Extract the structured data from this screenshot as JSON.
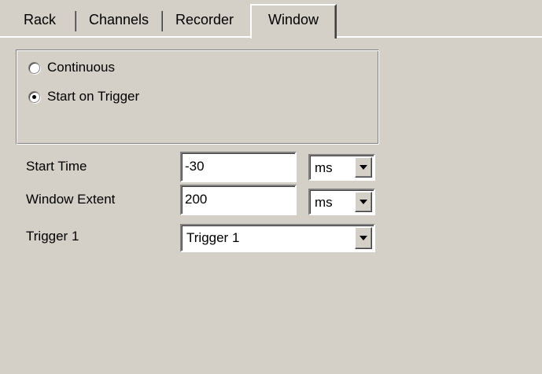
{
  "tabs": [
    {
      "label": "Rack",
      "active": false
    },
    {
      "label": "Channels",
      "active": false
    },
    {
      "label": "Recorder",
      "active": false
    },
    {
      "label": "Window",
      "active": true
    }
  ],
  "mode": {
    "options": [
      {
        "label": "Continuous",
        "selected": false
      },
      {
        "label": "Start on Trigger",
        "selected": true
      }
    ]
  },
  "form": {
    "start_time": {
      "label": "Start Time",
      "value": "-30",
      "unit": "ms"
    },
    "window_extent": {
      "label": "Window Extent",
      "value": "200",
      "unit": "ms"
    },
    "trigger": {
      "label": "Trigger 1",
      "value": "Trigger 1"
    }
  },
  "colors": {
    "face": "#d4d0c8",
    "highlight": "#ffffff",
    "shadow": "#808080"
  }
}
